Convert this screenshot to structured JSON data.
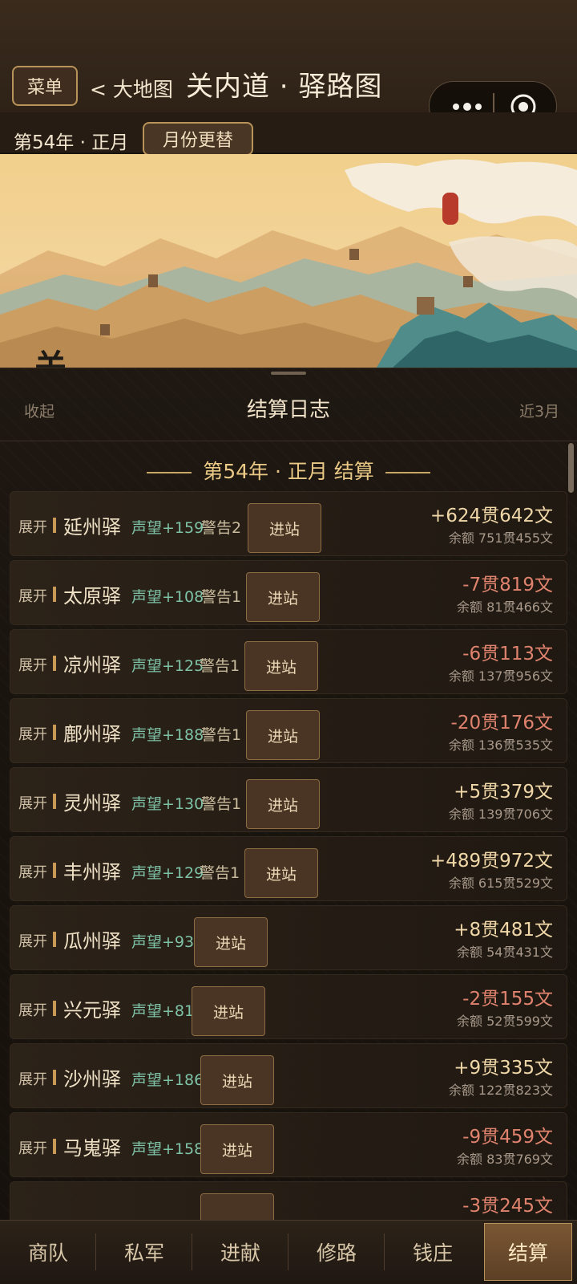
{
  "header": {
    "menu_label": "菜单",
    "back_label": "< 大地图",
    "title": "关内道 · 驿路图"
  },
  "year_bar": {
    "date_label": "第54年 · 正月",
    "switch_label": "月份更替"
  },
  "banner": {
    "vertical_title": "关内道驿程",
    "seal_icon": "red-seal-icon"
  },
  "log_panel": {
    "collapse_label": "收起",
    "title": "结算日志",
    "range_label": "近3月",
    "section_title": "第54年 · 正月 结算",
    "expand_label": "展开",
    "enter_label": "进站",
    "stations": [
      {
        "name": "延州驿",
        "reputation": "声望+159",
        "warning": "警告2",
        "amount": "+624贯642文",
        "balance": "余额 751贯455文",
        "sign": "pos"
      },
      {
        "name": "太原驿",
        "reputation": "声望+108",
        "warning": "警告1",
        "amount": "-7贯819文",
        "balance": "余额 81贯466文",
        "sign": "neg"
      },
      {
        "name": "凉州驿",
        "reputation": "声望+125",
        "warning": "警告1",
        "amount": "-6贯113文",
        "balance": "余额 137贯956文",
        "sign": "neg"
      },
      {
        "name": "鄜州驿",
        "reputation": "声望+188",
        "warning": "警告1",
        "amount": "-20贯176文",
        "balance": "余额 136贯535文",
        "sign": "neg"
      },
      {
        "name": "灵州驿",
        "reputation": "声望+130",
        "warning": "警告1",
        "amount": "+5贯379文",
        "balance": "余额 139贯706文",
        "sign": "pos"
      },
      {
        "name": "丰州驿",
        "reputation": "声望+129",
        "warning": "警告1",
        "amount": "+489贯972文",
        "balance": "余额 615贯529文",
        "sign": "pos"
      },
      {
        "name": "瓜州驿",
        "reputation": "声望+93",
        "warning": "",
        "amount": "+8贯481文",
        "balance": "余额 54贯431文",
        "sign": "pos"
      },
      {
        "name": "兴元驿",
        "reputation": "声望+81",
        "warning": "",
        "amount": "-2贯155文",
        "balance": "余额 52贯599文",
        "sign": "neg"
      },
      {
        "name": "沙州驿",
        "reputation": "声望+186",
        "warning": "",
        "amount": "+9贯335文",
        "balance": "余额 122贯823文",
        "sign": "pos"
      },
      {
        "name": "马嵬驿",
        "reputation": "声望+158",
        "warning": "",
        "amount": "-9贯459文",
        "balance": "余额 83贯769文",
        "sign": "neg"
      },
      {
        "name": "",
        "reputation": "",
        "warning": "",
        "amount": "-3贯245文",
        "balance": "",
        "sign": "neg"
      }
    ]
  },
  "tabs": [
    {
      "label": "商队",
      "active": false
    },
    {
      "label": "私军",
      "active": false
    },
    {
      "label": "进献",
      "active": false
    },
    {
      "label": "修路",
      "active": false
    },
    {
      "label": "钱庄",
      "active": false
    },
    {
      "label": "结算",
      "active": true
    }
  ],
  "colors": {
    "accent_gold": "#b8935a",
    "positive": "#f0d7a8",
    "negative": "#e0836e",
    "reputation": "#7fc3a7"
  }
}
